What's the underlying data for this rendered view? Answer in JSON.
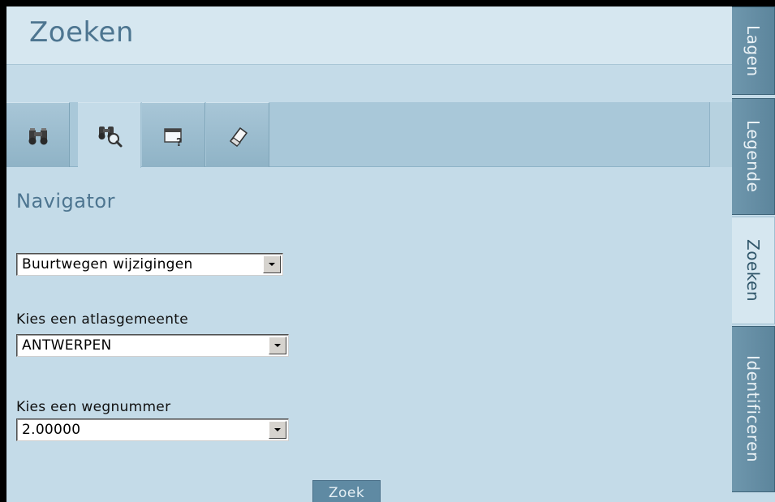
{
  "panel": {
    "title": "Zoeken"
  },
  "toolbar": {
    "tools": [
      {
        "icon": "binoculars-icon"
      },
      {
        "icon": "binoculars-search-icon",
        "active": true
      },
      {
        "icon": "window-help-icon"
      },
      {
        "icon": "eraser-icon"
      }
    ]
  },
  "navigator": {
    "title": "Navigator",
    "mode_select": {
      "value": "Buurtwegen wijzigingen"
    },
    "atlas": {
      "label": "Kies een atlasgemeente",
      "value": "ANTWERPEN"
    },
    "wegnummer": {
      "label": "Kies een wegnummer",
      "value": "2.00000"
    },
    "search_button": "Zoek"
  },
  "side_tabs": [
    {
      "label": "Lagen",
      "active": false
    },
    {
      "label": "Legende",
      "active": false
    },
    {
      "label": "Zoeken",
      "active": true
    },
    {
      "label": "Identificeren",
      "active": false
    }
  ],
  "colors": {
    "panel_bg": "#c4dbe8",
    "title_text": "#4d7590",
    "tab_bg": "#5c859c",
    "button_bg": "#5f8aa3"
  }
}
